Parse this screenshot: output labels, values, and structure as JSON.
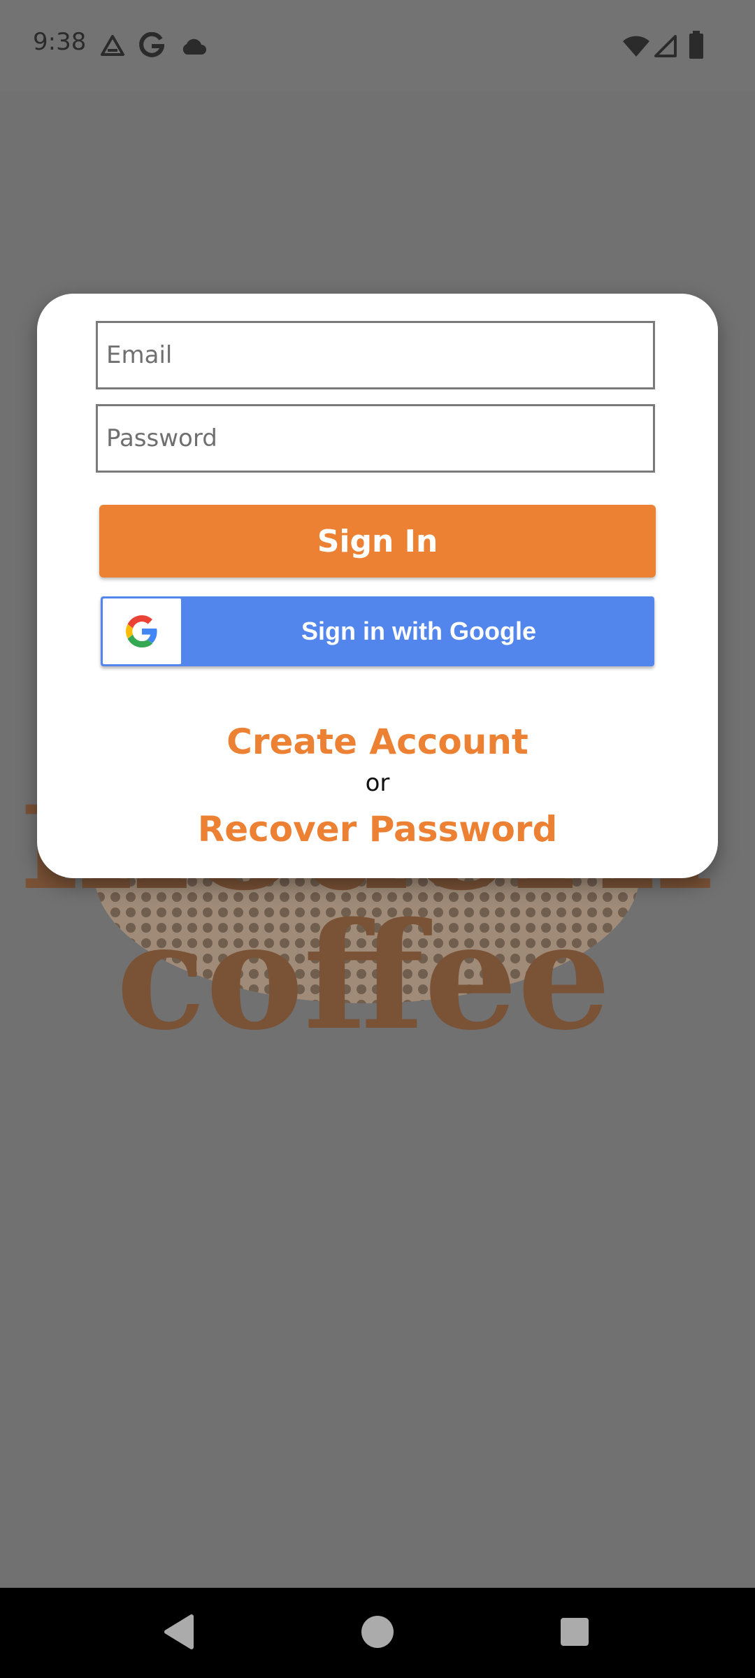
{
  "status_bar": {
    "time": "9:38",
    "left_icons": [
      "drive-icon",
      "google-icon",
      "cloud-icon"
    ],
    "right_icons": [
      "wifi-icon",
      "cell-signal-icon",
      "battery-icon"
    ]
  },
  "background_logo": {
    "text_top": "modern",
    "text_bottom": "coffee",
    "color": "#7a5236"
  },
  "dialog": {
    "email_placeholder": "Email",
    "password_placeholder": "Password",
    "sign_in_label": "Sign In",
    "google_label": "Sign in with Google",
    "create_account_label": "Create Account",
    "or_label": "or",
    "recover_password_label": "Recover Password"
  },
  "nav_bar": {
    "icons": [
      "back-icon",
      "home-icon",
      "recents-icon"
    ]
  },
  "colors": {
    "accent": "#ec8133",
    "google_blue": "#5286ec",
    "overlay": "#717171"
  }
}
